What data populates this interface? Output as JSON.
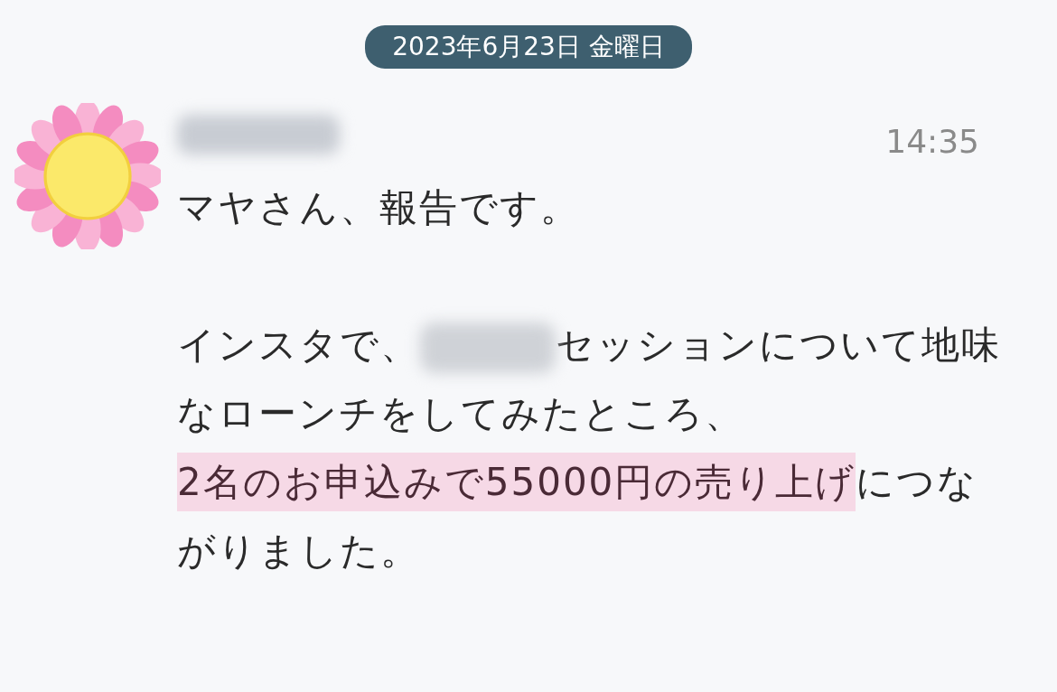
{
  "date_divider": "2023年6月23日 金曜日",
  "message": {
    "sender": {
      "kind": "redacted"
    },
    "time": "14:35",
    "paragraphs": [
      [
        {
          "kind": "text",
          "text": "マヤさん、報告です。"
        }
      ],
      [
        {
          "kind": "text",
          "text": "インスタで、"
        },
        {
          "kind": "redacted"
        },
        {
          "kind": "text",
          "text": "セッションについて地味なローンチをしてみたところ、"
        },
        {
          "kind": "break"
        },
        {
          "kind": "highlight",
          "text": "2名のお申込みで55000円の売り上げ"
        },
        {
          "kind": "text",
          "text": "につながりました。"
        }
      ]
    ]
  }
}
